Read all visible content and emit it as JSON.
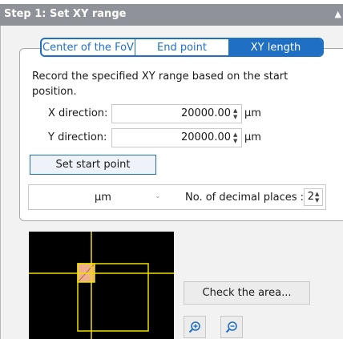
{
  "header": {
    "title": "Step 1: Set XY range",
    "collapse_icon": "triangle-up-icon"
  },
  "tabs": [
    {
      "label": "Center of the FoV",
      "active": false
    },
    {
      "label": "End point",
      "active": false
    },
    {
      "label": "XY length",
      "active": true
    }
  ],
  "description": "Record the specified XY range based on the start position.",
  "x_direction": {
    "label": "X direction:",
    "value": "20000.00",
    "unit": "µm"
  },
  "y_direction": {
    "label": "Y direction:",
    "value": "20000.00",
    "unit": "µm"
  },
  "set_start_point_label": "Set start point",
  "unit_select": {
    "value": "µm"
  },
  "decimal_places": {
    "label": "No. of decimal places :",
    "value": "2"
  },
  "check_area_label": "Check the area...",
  "zoom": {
    "in_icon": "zoom-in-icon",
    "out_icon": "zoom-out-icon"
  },
  "colors": {
    "accent": "#1f6fc5",
    "header_bg": "#8f9399",
    "crosshair": "#f0e000",
    "tile": "#f0b090"
  }
}
